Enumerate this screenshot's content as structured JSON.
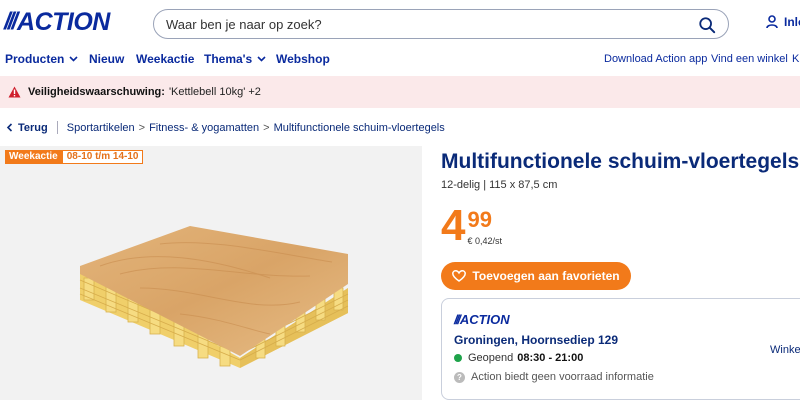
{
  "header": {
    "logo_slashes": "///",
    "logo_text": "ACTION",
    "search_placeholder": "Waar ben je naar op zoek?",
    "login_label": "Inloggen"
  },
  "nav": {
    "items": [
      {
        "label": "Producten",
        "dropdown": true
      },
      {
        "label": "Nieuw",
        "dropdown": false
      },
      {
        "label": "Weekactie",
        "dropdown": false
      },
      {
        "label": "Thema's",
        "dropdown": true
      },
      {
        "label": "Webshop",
        "dropdown": false
      }
    ],
    "right_items": [
      "Download Action app",
      "Vind een winkel",
      "Kl"
    ]
  },
  "warning": {
    "bold": "Veiligheidswaarschuwing:",
    "text": "'Kettlebell 10kg' +2"
  },
  "breadcrumb": {
    "back": "Terug",
    "items": [
      "Sportartikelen",
      "Fitness- & yogamatten",
      "Multifunctionele schuim-vloertegels"
    ]
  },
  "badge": {
    "label": "Weekactie",
    "dates": "08-10 t/m 14-10"
  },
  "product": {
    "title": "Multifunctionele schuim-vloertegels",
    "subtitle": "12-delig | 115 x 87,5 cm",
    "price_int": "4",
    "price_dec": "99",
    "unit_price": "€ 0,42/st",
    "favorite_button": "Toevoegen aan favorieten"
  },
  "store": {
    "logo_slashes": "///",
    "logo_text": "ACTION",
    "address": "Groningen, Hoornsediep 129",
    "status": "Geopend",
    "hours": "08:30 - 21:00",
    "stock_info": "Action biedt geen voorraad informatie",
    "change_label": "Winke",
    "status_color": "#1ea34a"
  },
  "colors": {
    "brand_blue": "#0a2a9e",
    "accent_orange": "#f27a1a",
    "warning_bg": "#fbe9ea",
    "warning_icon": "#d0202e"
  }
}
